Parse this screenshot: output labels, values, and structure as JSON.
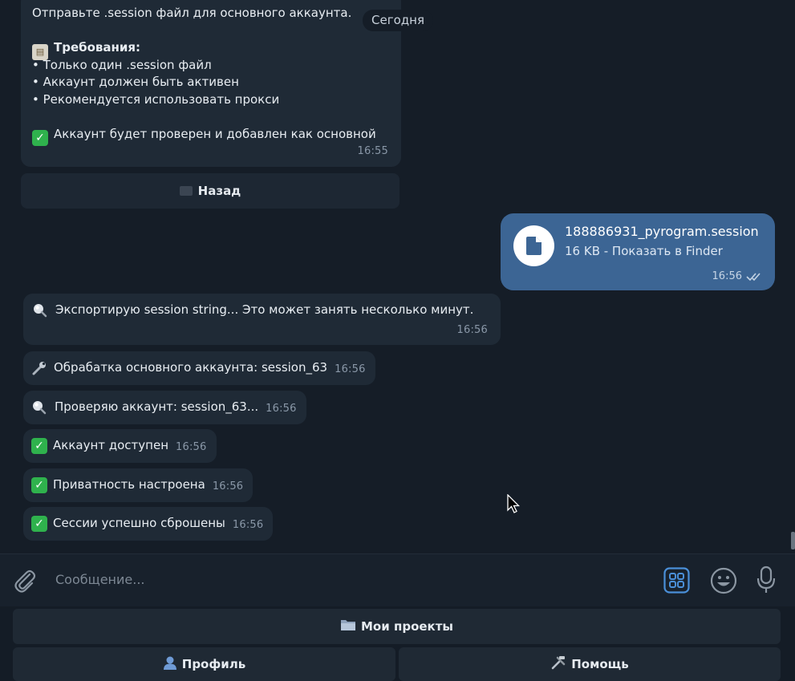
{
  "chat": {
    "date_badge": "Сегодня",
    "intro_message": {
      "line1": "Отправьте .session файл для основного аккаунта.",
      "req_title": "Требования:",
      "req1": "• Только один .session файл",
      "req2": "• Аккаунт должен быть активен",
      "req3": "• Рекомендуется использовать прокси",
      "result": "Аккаунт будет проверен и добавлен как основной",
      "time": "16:55"
    },
    "back_button": "Назад",
    "file_message": {
      "filename": "188886931_pyrogram.session",
      "meta": "16  KB - Показать в Finder",
      "time": "16:56"
    },
    "export_message": {
      "text": "Экспортирую session string... Это может занять несколько минут.",
      "time": "16:56"
    },
    "process_message": {
      "text": "Обрабатка основного аккаунта: session_63",
      "time": "16:56"
    },
    "check_message": {
      "text": "Проверяю аккаунт: session_63...",
      "time": "16:56"
    },
    "available_message": {
      "text": "Аккаунт доступен",
      "time": "16:56"
    },
    "privacy_message": {
      "text": "Приватность настроена",
      "time": "16:56"
    },
    "sessions_message": {
      "text": "Сессии успешно сброшены",
      "time": "16:56"
    }
  },
  "composer": {
    "placeholder": "Сообщение..."
  },
  "keyboard": {
    "projects": "Мои проекты",
    "profile": "Профиль",
    "help": "Помощь"
  },
  "colors": {
    "background": "#151d27",
    "bubble_in": "#1f2a36",
    "bubble_out": "#3c6594",
    "accent": "#4a8fd8",
    "check_green": "#2fb24d"
  },
  "icons": [
    "clipboard-icon",
    "check-icon",
    "search-icon",
    "wrench-icon",
    "file-icon",
    "attach-icon",
    "bot-menu-icon",
    "emoji-icon",
    "mic-icon",
    "folder-icon",
    "person-icon",
    "tools-icon"
  ]
}
